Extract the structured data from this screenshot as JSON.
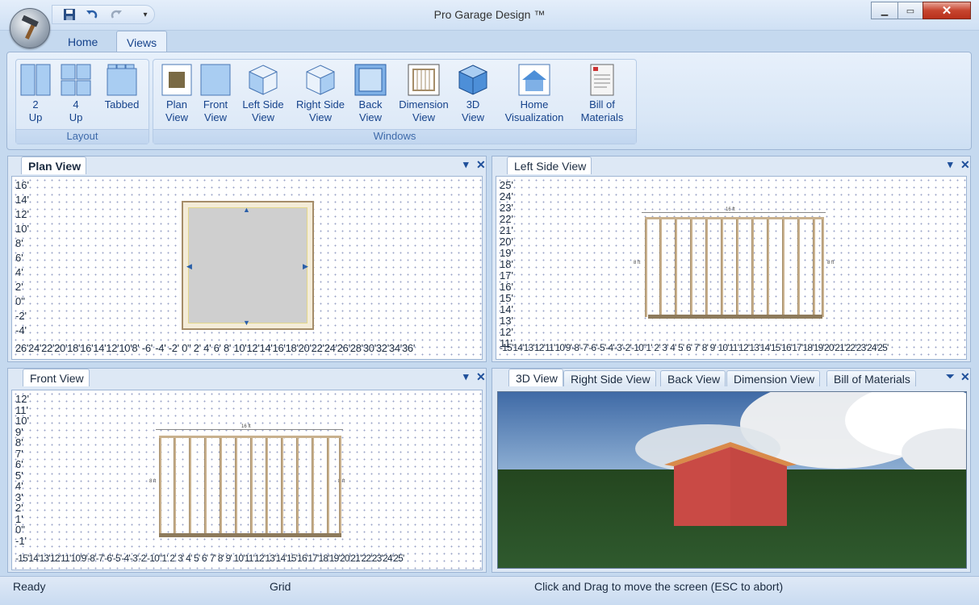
{
  "window": {
    "title": "Pro Garage Design ™"
  },
  "ribbon": {
    "tabs": [
      {
        "label": "Home"
      },
      {
        "label": "Views"
      }
    ],
    "layout_group": {
      "label": "Layout",
      "buttons": [
        {
          "label1": "2",
          "label2": "Up"
        },
        {
          "label1": "4",
          "label2": "Up"
        },
        {
          "label1": "Tabbed",
          "label2": ""
        }
      ]
    },
    "windows_group": {
      "label": "Windows",
      "buttons": [
        {
          "label1": "Plan",
          "label2": "View"
        },
        {
          "label1": "Front",
          "label2": "View"
        },
        {
          "label1": "Left Side",
          "label2": "View"
        },
        {
          "label1": "Right Side",
          "label2": "View"
        },
        {
          "label1": "Back",
          "label2": "View"
        },
        {
          "label1": "Dimension",
          "label2": "View"
        },
        {
          "label1": "3D",
          "label2": "View"
        },
        {
          "label1": "Home",
          "label2": "Visualization"
        },
        {
          "label1": "Bill of",
          "label2": "Materials"
        }
      ]
    }
  },
  "panels": {
    "plan": {
      "tab": "Plan View",
      "y_ticks": [
        "16'",
        "14'",
        "12'",
        "10'",
        "8'",
        "6'",
        "4'",
        "2'",
        "0\"",
        "-2'",
        "-4'"
      ],
      "x_ticks": "26'24'22'20'18'16'14'12'10'8' -6' -4' -2' 0\" 2'  4'  6'  8'  10'12'14'16'18'20'22'24'26'28'30'32'34'36'"
    },
    "left": {
      "tab": "Left Side View",
      "y_ticks": [
        "25'",
        "24'",
        "23'",
        "22'",
        "21'",
        "20'",
        "19'",
        "18'",
        "17'",
        "16'",
        "15'",
        "14'",
        "13'",
        "12'",
        "11'"
      ],
      "x_ticks": "-15'14'13'12'11'10'9'-8'-7'-6'-5'-4'-3'-2'-10\"1' 2' 3' 4' 5' 6' 7' 8' 9' 10'11'12'13'14'15'16'17'18'19'20'21'22'23'24'25'",
      "dim": "16 ft",
      "side_dim": "8 ft"
    },
    "front": {
      "tab": "Front View",
      "y_ticks": [
        "12'",
        "11'",
        "10'",
        "9'",
        "8'",
        "7'",
        "6'",
        "5'",
        "4'",
        "3'",
        "2'",
        "1'",
        "0\"",
        "-1'"
      ],
      "x_ticks": "-15'14'13'12'11'10'9'-8'-7'-6'-5'-4'-3'-2'-10\"1' 2' 3' 4' 5' 6' 7' 8' 9' 10'11'12'13'14'15'16'17'18'19'20'21'22'23'24'25'",
      "dim": "16 ft",
      "side_dim": "8 ft"
    },
    "tabbed": {
      "tabs": [
        {
          "label": "3D View"
        },
        {
          "label": "Right Side View"
        },
        {
          "label": "Back View"
        },
        {
          "label": "Dimension View"
        },
        {
          "label": "Bill of Materials"
        }
      ]
    }
  },
  "status": {
    "left": "Ready",
    "middle": "Grid",
    "right": "Click and Drag to move the screen  (ESC to abort)"
  },
  "colors": {
    "accent": "#15428b",
    "ribbon": "#dae7f6",
    "barn": "#c94a45",
    "grass": "#2f5a2e",
    "sky": "#4c78b0"
  }
}
